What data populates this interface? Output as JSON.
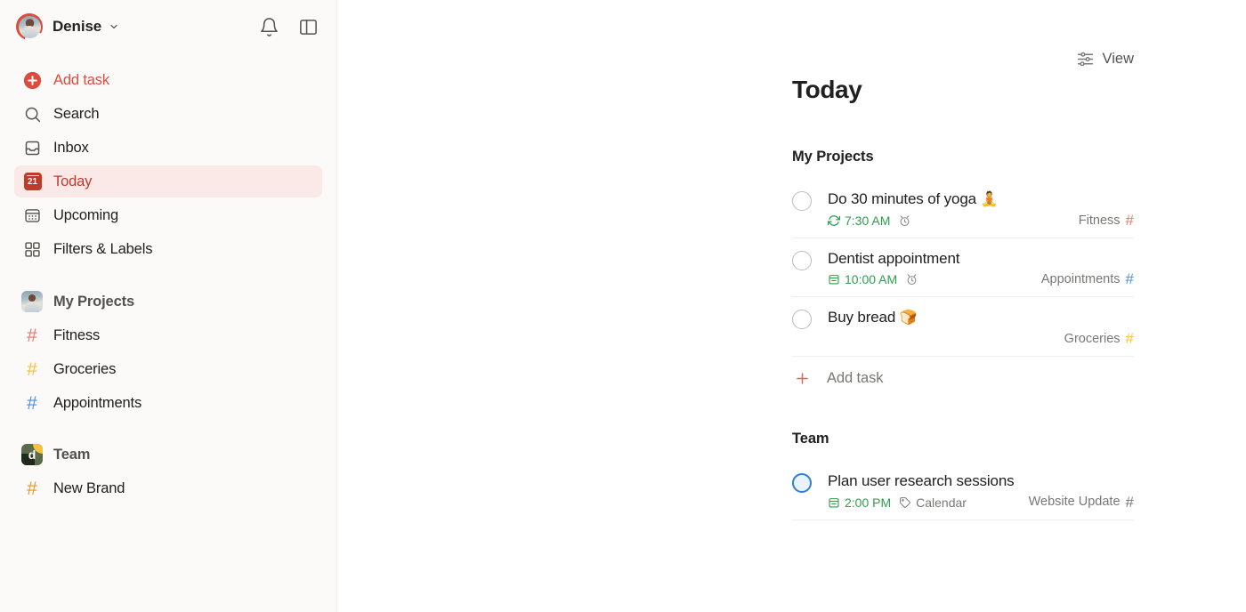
{
  "sidebar": {
    "user": {
      "name": "Denise",
      "avatar_icon": "user-avatar",
      "chevron_icon": "chevron-down-icon"
    },
    "header_actions": [
      {
        "name": "notifications",
        "icon": "bell-icon"
      },
      {
        "name": "toggle-sidebar",
        "icon": "sidebar-panel-icon"
      }
    ],
    "nav": [
      {
        "label": "Add task",
        "icon": "plus-circle-icon",
        "active": false
      },
      {
        "label": "Search",
        "icon": "search-icon",
        "active": false
      },
      {
        "label": "Inbox",
        "icon": "inbox-icon",
        "active": false
      },
      {
        "label": "Today",
        "icon": "calendar-21-icon",
        "active": true,
        "badge": "21"
      },
      {
        "label": "Upcoming",
        "icon": "calendar-grid-icon",
        "active": false
      },
      {
        "label": "Filters & Labels",
        "icon": "filters-labels-icon",
        "active": false
      }
    ],
    "groups": [
      {
        "title": "My Projects",
        "avatar_icon": "my-projects-avatar",
        "projects": [
          {
            "name": "Fitness",
            "color": "#E8786D"
          },
          {
            "name": "Groceries",
            "color": "#F5C23B"
          },
          {
            "name": "Appointments",
            "color": "#4A90E2"
          }
        ]
      },
      {
        "title": "Team",
        "avatar_icon": "team-avatar",
        "avatar_letter": "d",
        "projects": [
          {
            "name": "New Brand",
            "color": "#E8962F"
          }
        ]
      }
    ]
  },
  "main": {
    "view_button": {
      "label": "View",
      "icon": "sliders-icon"
    },
    "page_title": "Today",
    "sections": [
      {
        "title": "My Projects",
        "tasks": [
          {
            "title": "Do 30 minutes of yoga",
            "emoji": "🧘",
            "checkbox_style": "default",
            "due": "7:30 AM",
            "due_icon": "recurring-icon",
            "extra_icon": "alarm-clock-icon",
            "label": "",
            "label_icon": "",
            "project": "Fitness",
            "project_color": "#E8786D"
          },
          {
            "title": "Dentist appointment",
            "emoji": "",
            "checkbox_style": "default",
            "due": "10:00 AM",
            "due_icon": "calendar-icon",
            "extra_icon": "alarm-clock-icon",
            "label": "",
            "label_icon": "",
            "project": "Appointments",
            "project_color": "#4A90E2"
          },
          {
            "title": "Buy bread",
            "emoji": "🍞",
            "checkbox_style": "default",
            "due": "",
            "due_icon": "",
            "extra_icon": "",
            "label": "",
            "label_icon": "",
            "project": "Groceries",
            "project_color": "#F5C23B"
          }
        ],
        "add_task": {
          "label": "Add task",
          "icon": "plus-icon"
        }
      },
      {
        "title": "Team",
        "tasks": [
          {
            "title": "Plan user research sessions",
            "emoji": "",
            "checkbox_style": "blue",
            "due": "2:00 PM",
            "due_icon": "calendar-icon",
            "extra_icon": "",
            "label": "Calendar",
            "label_icon": "tag-icon",
            "project": "Website Update",
            "project_color": "#7A7874"
          }
        ],
        "add_task": null
      }
    ]
  },
  "colors": {
    "accent": "#DC4C3E",
    "sidebar_bg": "#FCFAF8",
    "active_bg": "#FBE9E7",
    "active_text": "#C0392B",
    "due_green": "#2E9E4F"
  }
}
